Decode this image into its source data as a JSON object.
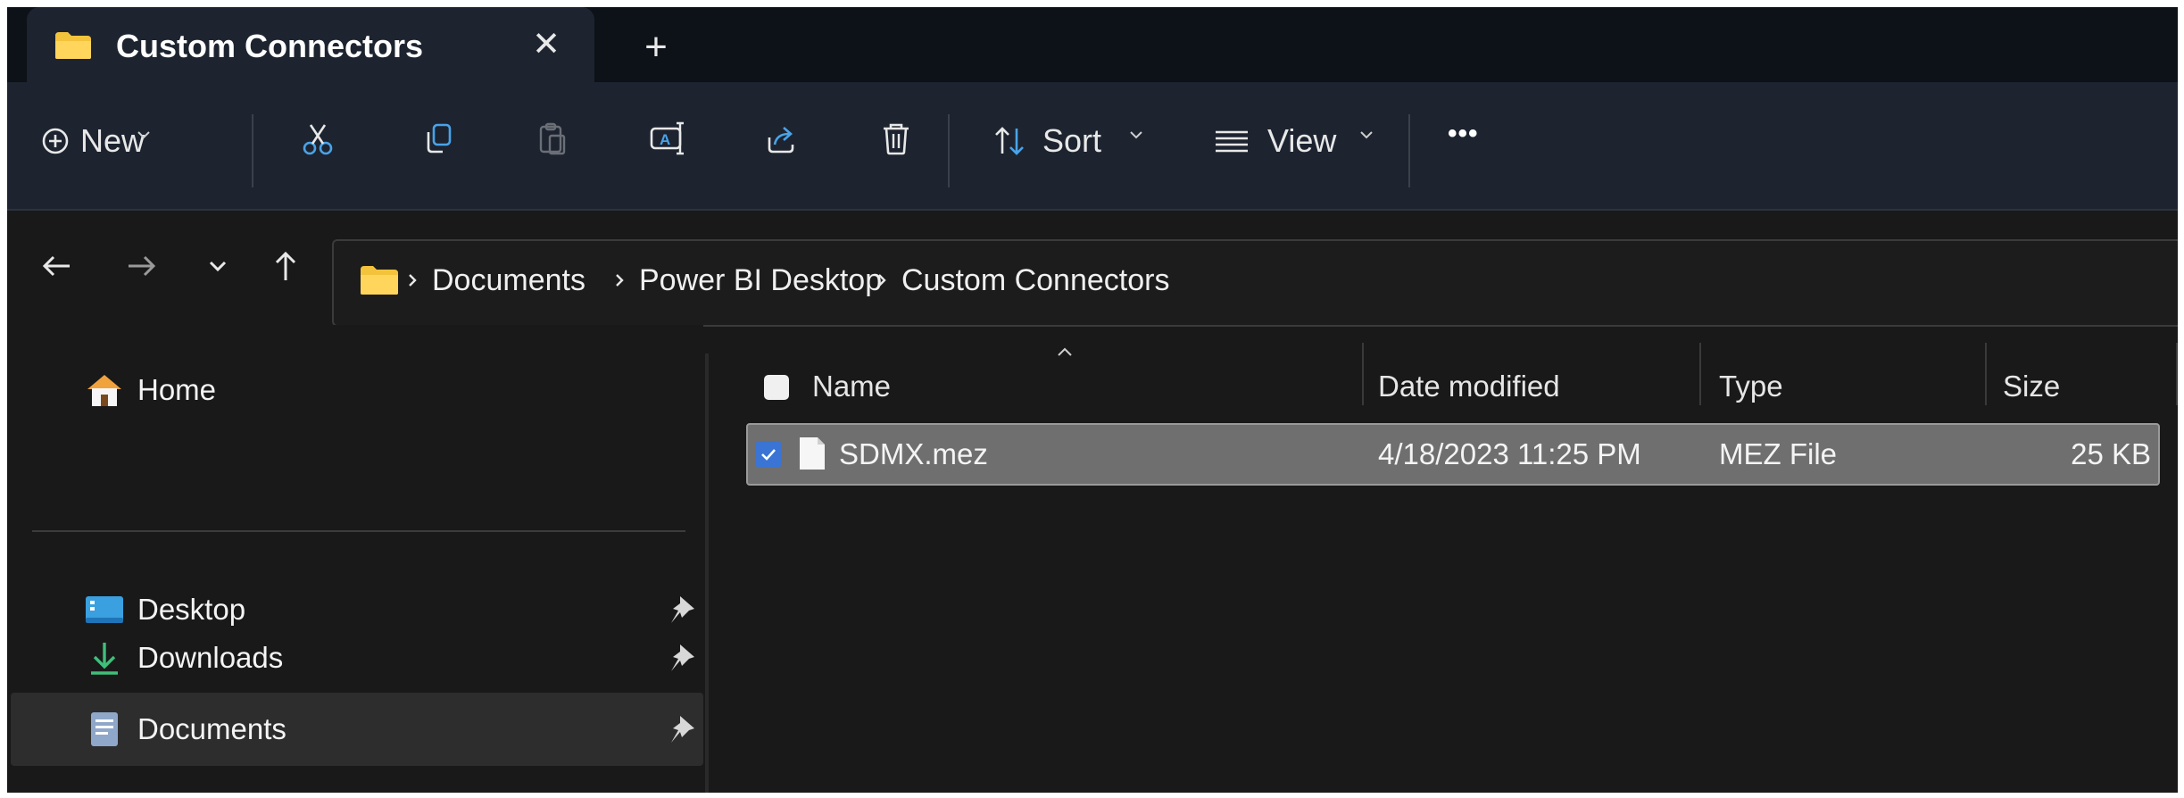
{
  "tab": {
    "title": "Custom Connectors",
    "close_glyph": "✕",
    "new_tab_glyph": "+"
  },
  "toolbar": {
    "new_label": "New",
    "sort_label": "Sort",
    "view_label": "View",
    "more_glyph": "•••",
    "icons": [
      "add-circle-icon",
      "cut-icon",
      "copy-icon",
      "paste-icon",
      "rename-icon",
      "share-icon",
      "delete-icon",
      "sort-icon",
      "view-icon",
      "more-icon"
    ]
  },
  "navigation": {
    "buttons": [
      "back-icon",
      "forward-icon",
      "recent-locations-icon",
      "up-icon"
    ],
    "breadcrumb": [
      "Documents",
      "Power BI Desktop",
      "Custom Connectors"
    ]
  },
  "sidebar": {
    "items": [
      {
        "label": "Home",
        "icon": "home-icon",
        "pinned": false
      },
      {
        "label": "Desktop",
        "icon": "desktop-icon",
        "pinned": true
      },
      {
        "label": "Downloads",
        "icon": "downloads-icon",
        "pinned": true
      },
      {
        "label": "Documents",
        "icon": "documents-icon",
        "pinned": true,
        "selected": true
      }
    ]
  },
  "file_list": {
    "columns": [
      "Name",
      "Date modified",
      "Type",
      "Size"
    ],
    "sorted_by": "Name",
    "rows": [
      {
        "name": "SDMX.mez",
        "date_modified": "4/18/2023 11:25 PM",
        "type": "MEZ File",
        "size": "25 KB",
        "selected": true
      }
    ]
  },
  "colors": {
    "titlebar_bg": "#0d1118",
    "toolbar_bg": "#1d2430",
    "window_bg": "#191919",
    "selected_row_bg": "#6f6f6f",
    "accent": "#3a74d4",
    "folder_yellow": "#f4c33c"
  }
}
